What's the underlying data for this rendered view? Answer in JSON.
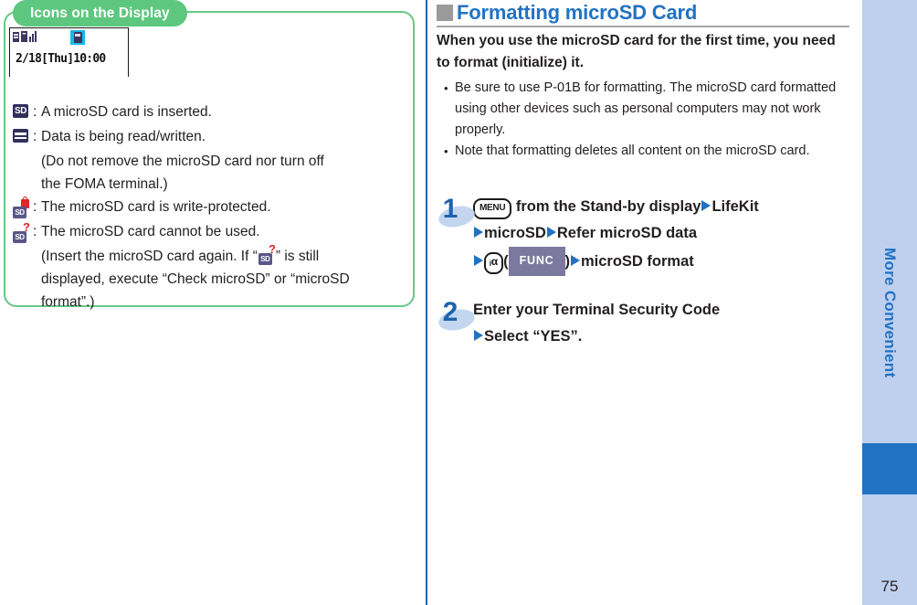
{
  "left_panel": {
    "tab_title": "Icons on the Display",
    "phone_display": {
      "clock": "2/18[Thu]10:00",
      "highlighted_icon": "microsd-card-icon"
    },
    "legend": [
      {
        "icon": "sd-card-icon",
        "colon": ":",
        "text": "A microSD card is inserted.",
        "continuation": []
      },
      {
        "icon": "read-write-icon",
        "colon": ":",
        "text": "Data is being read/written.",
        "continuation": [
          "(Do not remove the microSD card nor turn off",
          "the FOMA terminal.)"
        ]
      },
      {
        "icon": "sd-write-protected-icon",
        "colon": ":",
        "text": "The microSD card is write-protected.",
        "continuation": []
      },
      {
        "icon": "sd-unusable-icon",
        "colon": ":",
        "text": "The microSD card cannot be used.",
        "continuation": [
          "(Insert the microSD card again. If “",
          "” is still",
          "displayed, execute “Check microSD” or “microSD",
          "format”.)"
        ]
      }
    ]
  },
  "right_panel": {
    "heading": "Formatting microSD Card",
    "lead": "When you use the microSD card for the first time, you need to format (initialize) it.",
    "bullets": [
      "Be sure to use P-01B for formatting. The microSD card formatted using other devices such as personal computers may not work properly.",
      "Note that formatting deletes all content on the microSD card."
    ],
    "steps": [
      {
        "number": "1",
        "key_menu": "MENU",
        "text_1": "from the Stand-by display",
        "text_2": "LifeKit",
        "text_3": "microSD",
        "text_4": "Refer microSD data",
        "key_ia": "ᵢα",
        "softkey": "FUNC",
        "text_5": "microSD format"
      },
      {
        "number": "2",
        "text_1": "Enter your Terminal Security Code",
        "text_2": "Select “YES”."
      }
    ]
  },
  "side_tab": {
    "label": "More Convenient",
    "page_number": "75"
  },
  "colors": {
    "accent_blue": "#2272c4",
    "tab_green": "#5ec77f",
    "panel_border_green": "#68c887",
    "sidebar_bg": "#bed0ee",
    "sidebar_marker": "#2272c4",
    "divider_blue": "#1e66ab",
    "heading_square_gray": "#9b9b9b",
    "sd_icon_navy": "#332f5c",
    "badge_red": "#e0252b",
    "softkey_purple": "#7b7a9e",
    "highlight_cyan": "#19b8e8"
  }
}
